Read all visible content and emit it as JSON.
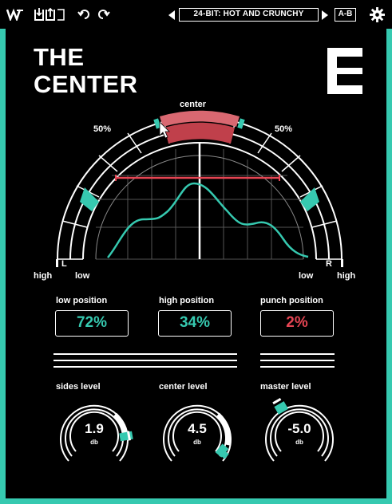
{
  "toolbar": {
    "preset_name": "24-BIT: HOT AND CRUNCHY",
    "ab_label": "A-B"
  },
  "header": {
    "title_line1": "THE",
    "title_line2": "CENTER"
  },
  "meter": {
    "center_label": "center",
    "left_pct_label": "50%",
    "right_pct_label": "50%",
    "left_channel": "L",
    "right_channel": "R",
    "left_high": "high",
    "left_low": "low",
    "right_low": "low",
    "right_high": "high"
  },
  "positions": [
    {
      "label": "low position",
      "value": "72%"
    },
    {
      "label": "high position",
      "value": "34%"
    },
    {
      "label": "punch position",
      "value": "2%"
    }
  ],
  "knobs": [
    {
      "label": "sides level",
      "value": "1.9",
      "unit": "db",
      "level": 0.72
    },
    {
      "label": "center level",
      "value": "4.5",
      "unit": "db",
      "level": 0.85
    },
    {
      "label": "master level",
      "value": "-5.0",
      "unit": "db",
      "level": 0.35
    }
  ],
  "colors": {
    "accent": "#36c9b0",
    "alert": "#e64553",
    "background": "#000000"
  }
}
